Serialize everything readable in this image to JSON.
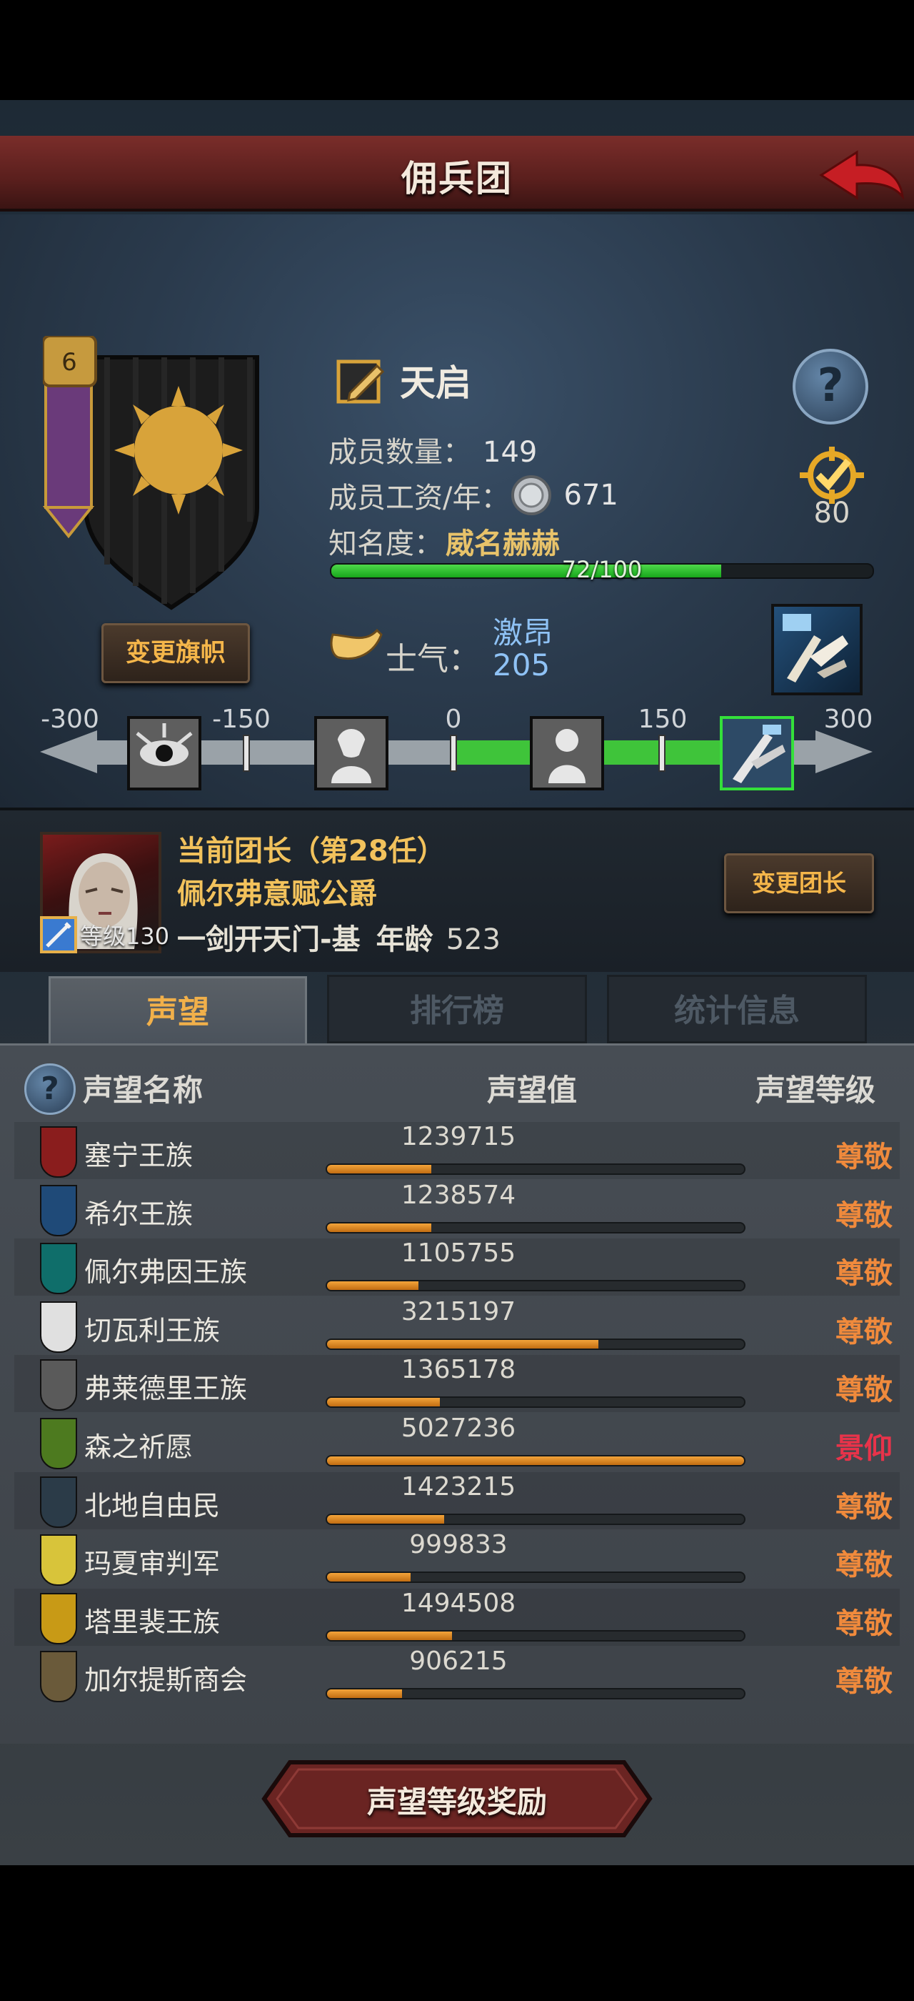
{
  "header": {
    "title": "佣兵团"
  },
  "company": {
    "name": "天启",
    "members_label": "成员数量：",
    "members_value": "149",
    "wage_label": "成员工资/年：",
    "wage_value": "671",
    "fame_label": "知名度：",
    "fame_value": "威名赫赫",
    "fame_progress": "72/100",
    "fame_fraction": 0.72,
    "level": "80",
    "change_flag_label": "变更旗帜"
  },
  "morale": {
    "label": "士气：",
    "state": "激昂",
    "value": "205",
    "scale_labels": [
      "-300",
      "-150",
      "0",
      "150",
      "300"
    ]
  },
  "leader": {
    "title": "当前团长（第28任）",
    "name": "佩尔弗意赋公爵",
    "skill": "一剑开天门-基",
    "age_label": "年龄",
    "age_value": "523",
    "level_label": "等级130",
    "change_leader_label": "变更团长"
  },
  "tabs": [
    "声望",
    "排行榜",
    "统计信息"
  ],
  "reputation": {
    "columns": [
      "声望名称",
      "声望值",
      "声望等级"
    ],
    "rows": [
      {
        "name": "塞宁王族",
        "value": "1239715",
        "level": "尊敬",
        "fill": 0.25,
        "crest_color": "#8a1d1d"
      },
      {
        "name": "希尔王族",
        "value": "1238574",
        "level": "尊敬",
        "fill": 0.25,
        "crest_color": "#1f4a78"
      },
      {
        "name": "佩尔弗因王族",
        "value": "1105755",
        "level": "尊敬",
        "fill": 0.22,
        "crest_color": "#0f6e6a"
      },
      {
        "name": "切瓦利王族",
        "value": "3215197",
        "level": "尊敬",
        "fill": 0.65,
        "crest_color": "#e0e0e0"
      },
      {
        "name": "弗莱德里王族",
        "value": "1365178",
        "level": "尊敬",
        "fill": 0.27,
        "crest_color": "#5a5a5a"
      },
      {
        "name": "森之祈愿",
        "value": "5027236",
        "level": "景仰",
        "fill": 1.0,
        "crest_color": "#4d7a1f"
      },
      {
        "name": "北地自由民",
        "value": "1423215",
        "level": "尊敬",
        "fill": 0.28,
        "crest_color": "#2b3b48"
      },
      {
        "name": "玛夏审判军",
        "value": "999833",
        "level": "尊敬",
        "fill": 0.2,
        "crest_color": "#d8c43a"
      },
      {
        "name": "塔里裴王族",
        "value": "1494508",
        "level": "尊敬",
        "fill": 0.3,
        "crest_color": "#c89a16"
      },
      {
        "name": "加尔提斯商会",
        "value": "906215",
        "level": "尊敬",
        "fill": 0.18,
        "crest_color": "#6a5a3a"
      }
    ]
  },
  "reward_button": "声望等级奖励",
  "colors": {
    "accent_gold": "#f2c25c",
    "level_orange": "#f08a3c",
    "level_red": "#e8334a",
    "progress_green": "#3fc43a"
  }
}
